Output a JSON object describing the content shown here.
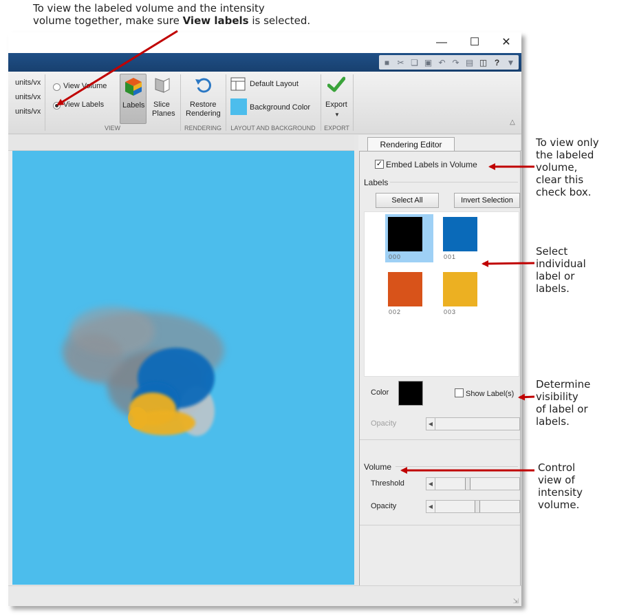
{
  "callouts": {
    "top_line1": "To view the labeled volume and the intensity",
    "top_line2_pre": "volume together, make sure ",
    "top_line2_bold": "View labels",
    "top_line2_post": " is selected.",
    "embed": [
      "To view only",
      "the labeled",
      "volume,",
      "clear this",
      "check box."
    ],
    "select": [
      "Select",
      "individual",
      "label or",
      "labels."
    ],
    "visibility": [
      "Determine",
      "visibility",
      "of label or",
      "labels."
    ],
    "volume": [
      "Control",
      "view of",
      "intensity",
      "volume."
    ]
  },
  "window": {
    "minimize": "—",
    "maximize": "☐",
    "close": "✕"
  },
  "quick_access": [
    "save-icon",
    "cut-icon",
    "copy-icon",
    "paste-icon",
    "undo-icon",
    "redo-icon",
    "print-icon",
    "window-icon",
    "help-icon",
    "dropdown-icon"
  ],
  "ribbon": {
    "units": [
      "units/vx",
      "units/vx",
      "units/vx"
    ],
    "view_volume": "View Volume",
    "view_labels": "View Labels",
    "labels_btn": "Labels",
    "slice_planes": [
      "Slice",
      "Planes"
    ],
    "restore_rendering": [
      "Restore",
      "Rendering"
    ],
    "default_layout": "Default Layout",
    "background_color": "Background Color",
    "background_color_value": "#4cbdec",
    "export": "Export",
    "groups": {
      "view": "VIEW",
      "rendering": "RENDERING",
      "layout": "LAYOUT AND BACKGROUND",
      "export": "EXPORT"
    },
    "selected_mode": "View Labels"
  },
  "editor": {
    "tab": "Rendering Editor",
    "embed_label": "Embed Labels in Volume",
    "embed_checked": true,
    "labels_heading": "Labels",
    "select_all": "Select All",
    "invert_selection": "Invert Selection",
    "labels": [
      {
        "id": "000",
        "color": "#000000",
        "selected": true
      },
      {
        "id": "001",
        "color": "#0a6ab9"
      },
      {
        "id": "002",
        "color": "#d8531a"
      },
      {
        "id": "003",
        "color": "#ecb022"
      }
    ],
    "color_label": "Color",
    "color_value": "#000000",
    "show_labels": "Show Label(s)",
    "show_labels_checked": false,
    "opacity_label": "Opacity",
    "volume_heading": "Volume",
    "threshold_label": "Threshold",
    "volume_opacity_label": "Opacity",
    "threshold_level": 0.42,
    "volume_opacity_level": 0.55
  },
  "colors": {
    "accent_arrow": "#c00000",
    "viewport_bg": "#4cbdec",
    "title_blue": "#1c4a7e"
  }
}
